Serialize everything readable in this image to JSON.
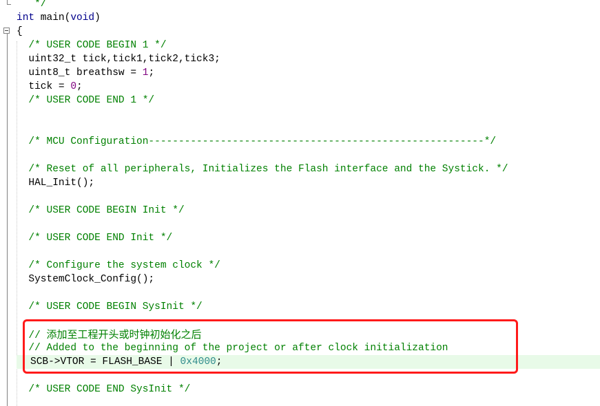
{
  "editor": {
    "lines": [
      {
        "id": "l0",
        "segments": [
          {
            "t": "   */",
            "c": "cm"
          }
        ]
      },
      {
        "id": "l1",
        "segments": [
          {
            "t": "int",
            "c": "kw"
          },
          {
            "t": " main(",
            "c": ""
          },
          {
            "t": "void",
            "c": "kw"
          },
          {
            "t": ")",
            "c": ""
          }
        ]
      },
      {
        "id": "l2",
        "segments": [
          {
            "t": "{",
            "c": ""
          }
        ]
      },
      {
        "id": "l3",
        "segments": [
          {
            "t": "  /* USER CODE BEGIN 1 */",
            "c": "cm"
          }
        ]
      },
      {
        "id": "l4",
        "segments": [
          {
            "t": "  uint32_t tick,tick1,tick2,tick3;",
            "c": ""
          }
        ]
      },
      {
        "id": "l5",
        "segments": [
          {
            "t": "  uint8_t breathsw = ",
            "c": ""
          },
          {
            "t": "1",
            "c": "num"
          },
          {
            "t": ";",
            "c": ""
          }
        ]
      },
      {
        "id": "l6",
        "segments": [
          {
            "t": "  tick = ",
            "c": ""
          },
          {
            "t": "0",
            "c": "num"
          },
          {
            "t": ";",
            "c": ""
          }
        ]
      },
      {
        "id": "l7",
        "segments": [
          {
            "t": "  /* USER CODE END 1 */",
            "c": "cm"
          }
        ]
      },
      {
        "id": "l8",
        "segments": []
      },
      {
        "id": "l9",
        "segments": []
      },
      {
        "id": "l10",
        "segments": [
          {
            "t": "  /* MCU Configuration--------------------------------------------------------*/",
            "c": "cm"
          }
        ]
      },
      {
        "id": "l11",
        "segments": []
      },
      {
        "id": "l12",
        "segments": [
          {
            "t": "  /* Reset of all peripherals, Initializes the Flash interface and the Systick. */",
            "c": "cm"
          }
        ]
      },
      {
        "id": "l13",
        "segments": [
          {
            "t": "  HAL_Init();",
            "c": ""
          }
        ]
      },
      {
        "id": "l14",
        "segments": []
      },
      {
        "id": "l15",
        "segments": [
          {
            "t": "  /* USER CODE BEGIN Init */",
            "c": "cm"
          }
        ]
      },
      {
        "id": "l16",
        "segments": []
      },
      {
        "id": "l17",
        "segments": [
          {
            "t": "  /* USER CODE END Init */",
            "c": "cm"
          }
        ]
      },
      {
        "id": "l18",
        "segments": []
      },
      {
        "id": "l19",
        "segments": [
          {
            "t": "  /* Configure the system clock */",
            "c": "cm"
          }
        ]
      },
      {
        "id": "l20",
        "segments": [
          {
            "t": "  SystemClock_Config();",
            "c": ""
          }
        ]
      },
      {
        "id": "l21",
        "segments": []
      },
      {
        "id": "l22",
        "segments": [
          {
            "t": "  /* USER CODE BEGIN SysInit */",
            "c": "cm"
          }
        ]
      },
      {
        "id": "l23",
        "segments": []
      },
      {
        "id": "l24",
        "segments": [
          {
            "t": "  // ",
            "c": "cm"
          },
          {
            "t": "添加至工程开头或时钟初始化之后",
            "c": "cm-cn"
          }
        ]
      },
      {
        "id": "l25",
        "segments": [
          {
            "t": "  // Added to the beginning of the project or after clock initialization",
            "c": "cm"
          }
        ]
      },
      {
        "id": "l26",
        "segments": [
          {
            "t": "SCB->VTOR = FLASH_BASE | ",
            "c": ""
          },
          {
            "t": "0x4000",
            "c": "hex"
          },
          {
            "t": ";",
            "c": ""
          }
        ],
        "current": true
      },
      {
        "id": "l27",
        "segments": []
      },
      {
        "id": "l28",
        "segments": [
          {
            "t": "  /* USER CODE END SysInit */",
            "c": "cm"
          }
        ]
      }
    ]
  }
}
